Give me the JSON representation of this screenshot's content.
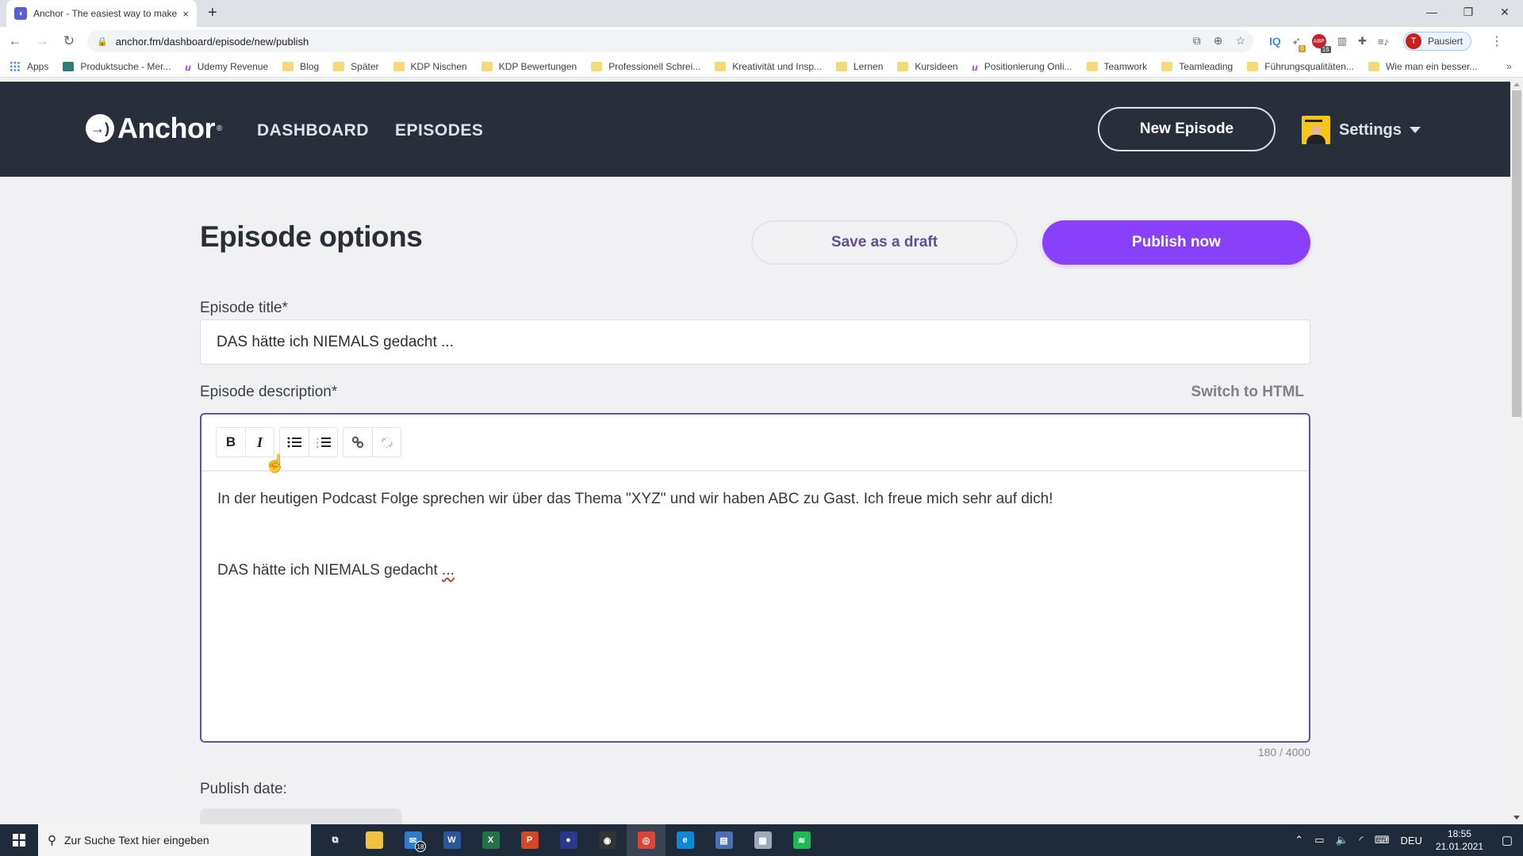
{
  "browser": {
    "tab_title": "Anchor - The easiest way to make",
    "tab_close": "×",
    "new_tab": "+",
    "url": "anchor.fm/dashboard/episode/new/publish",
    "profile_initial": "T",
    "profile_status": "Pausiert",
    "extension_badges": {
      "hummingbird": "0",
      "adblock": "16"
    },
    "window_controls": {
      "minimize": "—",
      "restore": "❐",
      "close": "✕"
    },
    "bookmarks": [
      {
        "icon": "apps",
        "label": "Apps"
      },
      {
        "icon": "shirt",
        "label": "Produktsuche - Mer..."
      },
      {
        "icon": "udemy",
        "label": "Udemy Revenue"
      },
      {
        "icon": "folder",
        "label": "Blog"
      },
      {
        "icon": "folder",
        "label": "Später"
      },
      {
        "icon": "folder",
        "label": "KDP Nischen"
      },
      {
        "icon": "folder",
        "label": "KDP Bewertungen"
      },
      {
        "icon": "folder",
        "label": "Professionell Schrei..."
      },
      {
        "icon": "folder",
        "label": "Kreativität und Insp..."
      },
      {
        "icon": "folder",
        "label": "Lernen"
      },
      {
        "icon": "folder",
        "label": "Kursideen"
      },
      {
        "icon": "udemy",
        "label": "Positionierung Onli..."
      },
      {
        "icon": "folder",
        "label": "Teamwork"
      },
      {
        "icon": "folder",
        "label": "Teamleading"
      },
      {
        "icon": "folder",
        "label": "Führungsqualitäten..."
      },
      {
        "icon": "folder",
        "label": "Wie man ein besser..."
      }
    ],
    "bookmarks_more": "»"
  },
  "header": {
    "logo_text": "Anchor",
    "logo_reg": "®",
    "nav": [
      "DASHBOARD",
      "EPISODES"
    ],
    "new_episode_label": "New Episode",
    "settings_label": "Settings"
  },
  "page": {
    "title": "Episode options",
    "save_draft_label": "Save as a draft",
    "publish_label": "Publish now",
    "episode_title_label": "Episode title*",
    "episode_title_value": "DAS hätte ich NIEMALS gedacht ...",
    "episode_description_label": "Episode description*",
    "switch_html_label": "Switch to HTML",
    "description_paragraphs": [
      "In der heutigen Podcast Folge sprechen wir über das Thema \"XYZ\" und wir haben ABC zu Gast. Ich freue mich sehr auf dich!",
      "DAS hätte ich NIEMALS gedacht "
    ],
    "description_trailing": "...",
    "char_count": "180 / 4000",
    "publish_date_label": "Publish date:",
    "toolbar": {
      "bold": "B",
      "italic": "I",
      "bullet_list": "☰",
      "numbered_list": "☷",
      "link": "🔗",
      "unlink": "⛓"
    }
  },
  "colors": {
    "brand_purple": "#8940fa",
    "header_bg": "#292f3a",
    "editor_border": "#6a4f9a"
  },
  "taskbar": {
    "search_placeholder": "Zur Suche Text hier eingeben",
    "mail_badge": "18",
    "language": "DEU",
    "time": "18:55",
    "date": "21.01.2021",
    "apps": [
      {
        "name": "task-view",
        "glyph": "⧉",
        "color": "transparent"
      },
      {
        "name": "file-explorer",
        "glyph": "",
        "color": "#f0c33c"
      },
      {
        "name": "mail",
        "glyph": "✉",
        "color": "#2b7cd3"
      },
      {
        "name": "word",
        "glyph": "W",
        "color": "#2b579a"
      },
      {
        "name": "excel",
        "glyph": "X",
        "color": "#217346"
      },
      {
        "name": "powerpoint",
        "glyph": "P",
        "color": "#d24726"
      },
      {
        "name": "app-orange",
        "glyph": "●",
        "color": "#2a3a8a"
      },
      {
        "name": "obs",
        "glyph": "◉",
        "color": "#333"
      },
      {
        "name": "chrome",
        "glyph": "◎",
        "color": "#db4437"
      },
      {
        "name": "edge",
        "glyph": "e",
        "color": "#0c8ad6"
      },
      {
        "name": "app-doc",
        "glyph": "▤",
        "color": "#4a6fb5"
      },
      {
        "name": "notepad",
        "glyph": "▦",
        "color": "#9ab"
      },
      {
        "name": "spotify",
        "glyph": "≋",
        "color": "#1db954"
      }
    ]
  }
}
